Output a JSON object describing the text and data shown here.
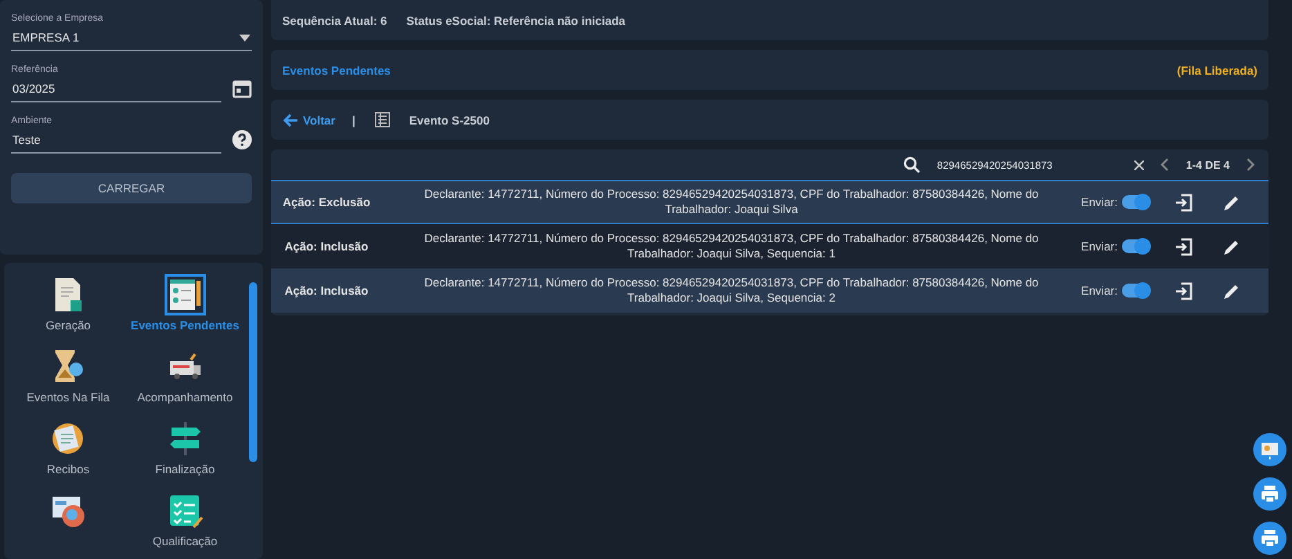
{
  "form": {
    "company": {
      "label": "Selecione a Empresa",
      "value": "EMPRESA 1"
    },
    "reference": {
      "label": "Referência",
      "value": "03/2025"
    },
    "environment": {
      "label": "Ambiente",
      "value": "Teste"
    },
    "load_button": "CARREGAR"
  },
  "menu": [
    {
      "label": "Geração",
      "selected": false
    },
    {
      "label": "Eventos Pendentes",
      "selected": true
    },
    {
      "label": "Eventos Na Fila",
      "selected": false
    },
    {
      "label": "Acompanhamento",
      "selected": false
    },
    {
      "label": "Recibos",
      "selected": false
    },
    {
      "label": "Finalização",
      "selected": false
    },
    {
      "selected": false
    },
    {
      "label": "Qualificação",
      "selected": false
    }
  ],
  "status": {
    "sequence": "Sequência Atual: 6",
    "esocial": "Status eSocial: Referência não iniciada"
  },
  "pending": {
    "title": "Eventos Pendentes",
    "queue": "(Fila Liberada)"
  },
  "nav": {
    "back": "Voltar",
    "separator": "|",
    "event": "Evento S-2500"
  },
  "table": {
    "search": "82946529420254031873",
    "pagination": "1-4 DE 4",
    "rows": [
      {
        "action": "Ação: Exclusão",
        "description": "Declarante: 14772711, Número do Processo: 82946529420254031873, CPF do Trabalhador: 87580384426, Nome do Trabalhador: Joaqui Silva",
        "send_label": "Enviar:",
        "send": true,
        "selected": true
      },
      {
        "action": "Ação: Inclusão",
        "description": "Declarante: 14772711, Número do Processo: 82946529420254031873, CPF do Trabalhador: 87580384426, Nome do Trabalhador: Joaqui Silva, Sequencia: 1",
        "send_label": "Enviar:",
        "send": true,
        "selected": false
      },
      {
        "action": "Ação: Inclusão",
        "description": "Declarante: 14772711, Número do Processo: 82946529420254031873, CPF do Trabalhador: 87580384426, Nome do Trabalhador: Joaqui Silva, Sequencia: 2",
        "send_label": "Enviar:",
        "send": true,
        "selected": false
      }
    ]
  }
}
